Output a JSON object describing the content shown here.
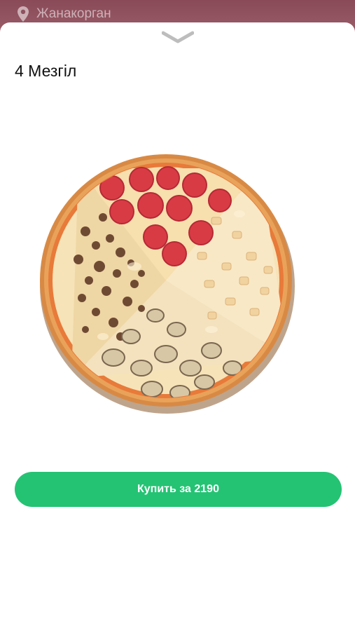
{
  "header": {
    "city": "Жанакорган"
  },
  "product": {
    "title": "4 Мезгіл"
  },
  "actions": {
    "buy_label": "Купить за 2190"
  },
  "colors": {
    "accent": "#24c373",
    "topbar": "#8a4a58"
  }
}
